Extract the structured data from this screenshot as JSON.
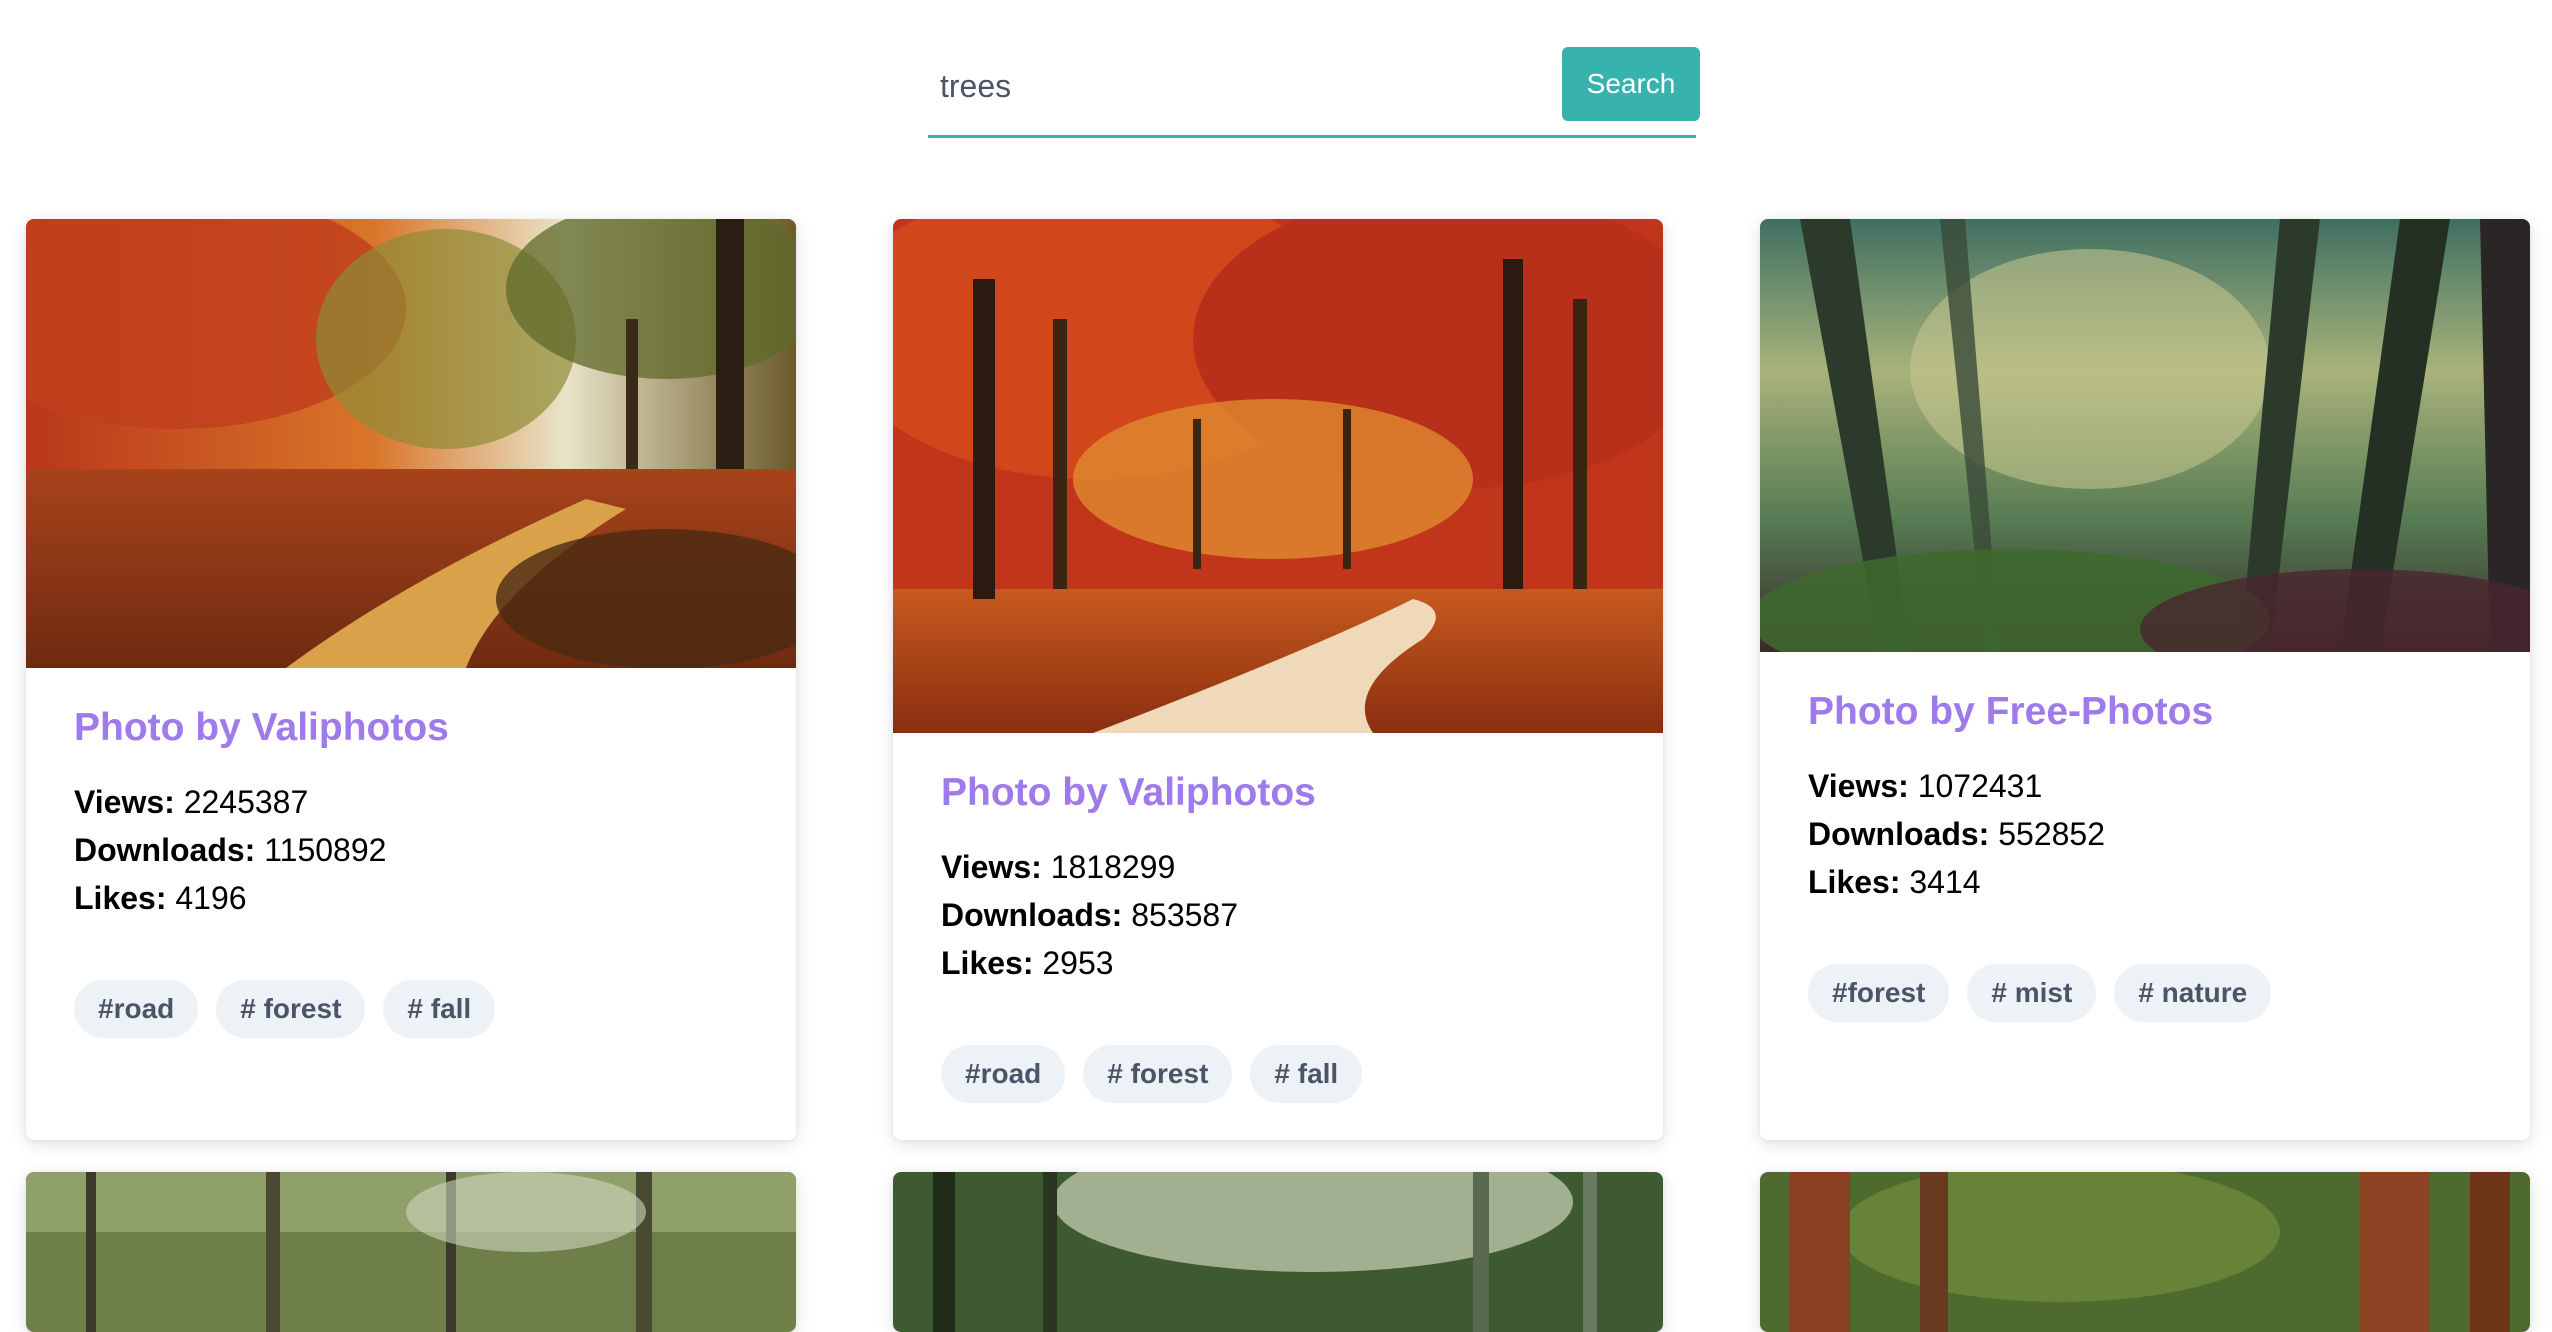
{
  "search": {
    "value": "trees",
    "button_label": "Search"
  },
  "cards": [
    {
      "author": "Photo by Valiphotos",
      "views_label": "Views:",
      "views": "2245387",
      "downloads_label": "Downloads:",
      "downloads": "1150892",
      "likes_label": "Likes:",
      "likes": "4196",
      "tags": [
        "#road",
        "# forest",
        "# fall"
      ]
    },
    {
      "author": "Photo by Valiphotos",
      "views_label": "Views:",
      "views": "1818299",
      "downloads_label": "Downloads:",
      "downloads": "853587",
      "likes_label": "Likes:",
      "likes": "2953",
      "tags": [
        "#road",
        "# forest",
        "# fall"
      ]
    },
    {
      "author": "Photo by Free-Photos",
      "views_label": "Views:",
      "views": "1072431",
      "downloads_label": "Downloads:",
      "downloads": "552852",
      "likes_label": "Likes:",
      "likes": "3414",
      "tags": [
        "#forest",
        "# mist",
        "# nature"
      ]
    }
  ],
  "colors": {
    "accent": "#38b2ac",
    "author": "#9f7aea",
    "tag_bg": "#edf2f7"
  }
}
